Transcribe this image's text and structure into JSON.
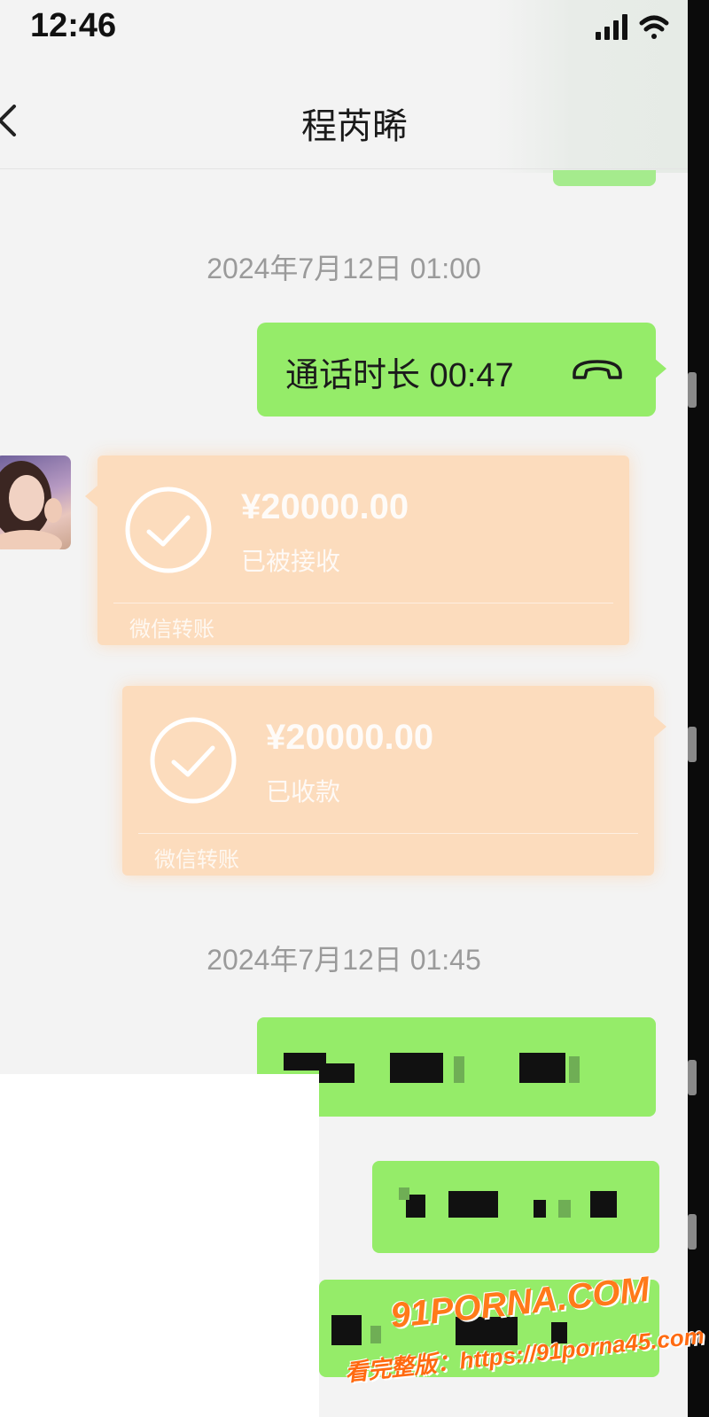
{
  "status_bar": {
    "time": "12:46"
  },
  "header": {
    "title": "程芮晞"
  },
  "messages": {
    "timestamp_1": "2024年7月12日 01:00",
    "call": {
      "label": "通话时长 00:47"
    },
    "transfer_received": {
      "amount": "¥20000.00",
      "status": "已被接收",
      "source": "微信转账"
    },
    "transfer_collected": {
      "amount": "¥20000.00",
      "status": "已收款",
      "source": "微信转账"
    },
    "timestamp_2": "2024年7月12日 01:45"
  },
  "watermark": {
    "logo": "91PORNA.COM",
    "url": "看完整版：https://91porna45.com"
  },
  "colors": {
    "bubble_green": "#95ec69",
    "transfer_orange": "#fcdcbd",
    "background": "#f3f3f3",
    "watermark_orange": "#ff7a1a"
  },
  "icons": [
    "back-arrow-icon",
    "signal-icon",
    "wifi-icon",
    "phone-hangup-icon",
    "check-circle-icon"
  ]
}
